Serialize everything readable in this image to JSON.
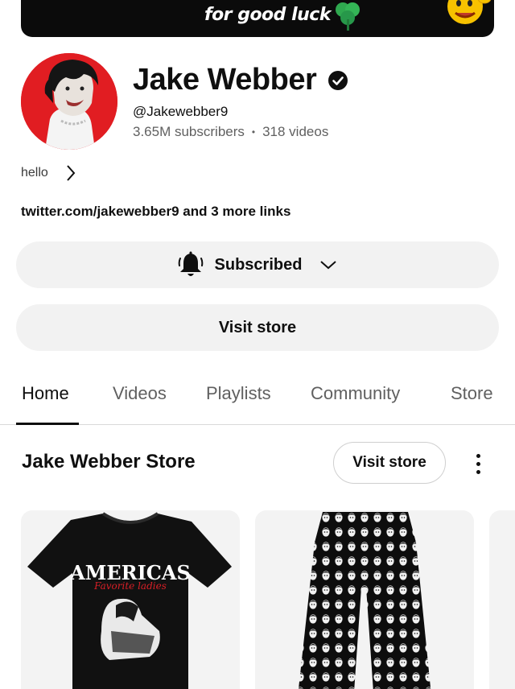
{
  "banner": {
    "text": "for good luck",
    "icons": [
      "clover-icon",
      "emoji-icon"
    ]
  },
  "channel": {
    "name": "Jake Webber",
    "handle": "@Jakewebber9",
    "subscribers": "3.65M subscribers",
    "separator": "•",
    "videos": "318 videos",
    "description": "hello",
    "links": "twitter.com/jakewebber9 and 3 more links",
    "avatar_bg": "#e11d22"
  },
  "actions": {
    "subscribed_label": "Subscribed",
    "visit_store_label": "Visit store"
  },
  "tabs": [
    {
      "label": "Home",
      "active": true
    },
    {
      "label": "Videos"
    },
    {
      "label": "Playlists"
    },
    {
      "label": "Community"
    },
    {
      "label": "Store"
    }
  ],
  "store_section": {
    "title": "Jake Webber Store",
    "visit_store_label": "Visit store",
    "shirt_print_title": "AMERICAS",
    "shirt_print_sub": "Favorite ladies"
  },
  "colors": {
    "accent": "#0f0f0f",
    "secondary_text": "#606060",
    "pill_bg": "#f2f2f2"
  }
}
